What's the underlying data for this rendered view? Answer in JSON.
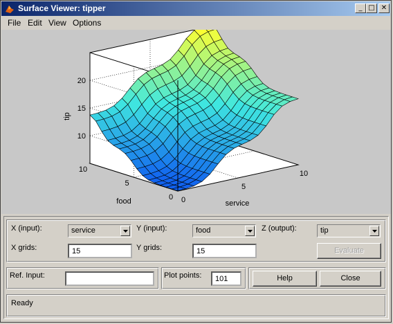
{
  "window": {
    "title": "Surface Viewer: tipper",
    "min_label": "_",
    "max_label": "□",
    "close_label": "✕"
  },
  "menu": {
    "items": [
      "File",
      "Edit",
      "View",
      "Options"
    ]
  },
  "plot": {
    "zlabel": "tip",
    "xlabel": "service",
    "ylabel": "food",
    "z_ticks": [
      "10",
      "15",
      "20"
    ],
    "x_ticks": [
      "0",
      "5",
      "10"
    ],
    "y_ticks": [
      "0",
      "5",
      "10"
    ],
    "colors": {
      "high": "#ffff30",
      "mid": "#40e8e0",
      "low": "#1060f0"
    }
  },
  "controls": {
    "x_input_label": "X (input):",
    "x_input_value": "service",
    "y_input_label": "Y (input):",
    "y_input_value": "food",
    "z_output_label": "Z (output):",
    "z_output_value": "tip",
    "x_grids_label": "X grids:",
    "x_grids_value": "15",
    "y_grids_label": "Y grids:",
    "y_grids_value": "15",
    "evaluate_label": "Evaluate",
    "ref_input_label": "Ref. Input:",
    "ref_input_value": "",
    "plot_points_label": "Plot points:",
    "plot_points_value": "101",
    "help_label": "Help",
    "close_label": "Close"
  },
  "status": {
    "text": "Ready"
  }
}
